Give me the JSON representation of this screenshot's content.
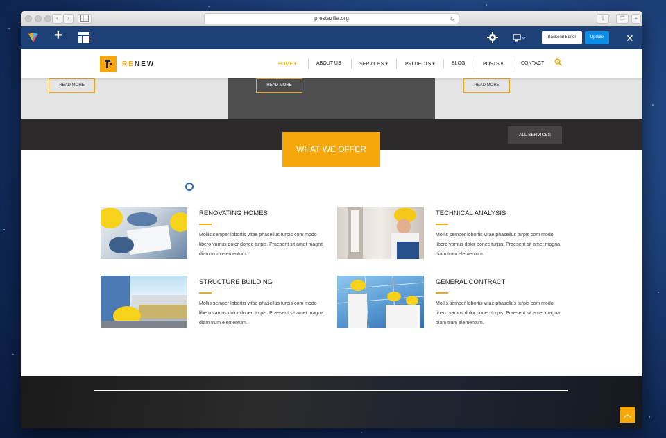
{
  "browser": {
    "url": "prestazilla.org",
    "reload_glyph": "↻",
    "back_glyph": "‹",
    "forward_glyph": "›"
  },
  "editor_toolbar": {
    "add_glyph": "+",
    "backend_editor_label": "Backend Editor",
    "update_label": "Update",
    "close_glyph": "✕",
    "accent_color": "#1d4077",
    "update_color": "#0d8de6"
  },
  "site": {
    "logo_prefix": "RE",
    "logo_suffix": "NEW",
    "brand_color": "#f5a70b",
    "nav": [
      {
        "label": "HOME",
        "caret": "▾",
        "active": true
      },
      {
        "label": "ABOUT US",
        "caret": ""
      },
      {
        "label": "SERVICES",
        "caret": "▾"
      },
      {
        "label": "PROJECTS",
        "caret": "▾"
      },
      {
        "label": "BLOG",
        "caret": ""
      },
      {
        "label": "POSTS",
        "caret": "▾"
      },
      {
        "label": "CONTACT",
        "caret": ""
      }
    ]
  },
  "slider": {
    "read_more_label": "READ MORE"
  },
  "offer": {
    "badge": "WHAT WE OFFER",
    "all_services_label": "ALL SERVICES"
  },
  "services": [
    {
      "title": "RENOVATING HOMES",
      "text": "Mollis semper lobortis vitae phasellus turpis com modo libero vamus dolor donec turpis. Praesent sit amet magna diam trum elementum."
    },
    {
      "title": "TECHNICAL ANALYSIS",
      "text": "Mollis semper lobortis vitae phasellus turpis com modo libero vamus dolor donec turpis. Praesent sit amet magna diam trum elementum."
    },
    {
      "title": "STRUCTURE BUILDING",
      "text": "Mollis semper lobortis vitae phasellus turpis com modo libero vamus dolor donec turpis. Praesent sit amet magna diam trum elementum."
    },
    {
      "title": "GENERAL CONTRACT",
      "text": "Mollis semper lobortis vitae phasellus turpis com modo libero vamus dolor donec turpis. Praesent sit amet magna diam trum elementum."
    }
  ],
  "footer": {
    "to_top_glyph": "︿"
  }
}
